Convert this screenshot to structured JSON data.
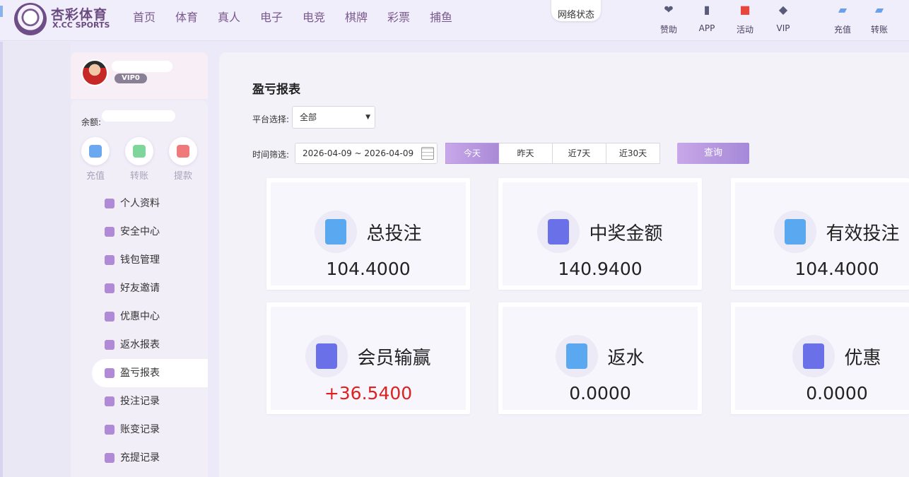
{
  "brand": {
    "name": "杏彩体育",
    "sub": "X.CC SPORTS"
  },
  "nav": [
    "首页",
    "体育",
    "真人",
    "电子",
    "电竞",
    "棋牌",
    "彩票",
    "捕鱼"
  ],
  "network_status": "网络状态",
  "header_icons": [
    {
      "label": "赞助",
      "icon": "heart-hands-icon",
      "color": "#5a5a7a"
    },
    {
      "label": "APP",
      "icon": "phone-icon",
      "color": "#5a5a7a"
    },
    {
      "label": "活动",
      "icon": "gift-icon",
      "color": "#e8453c"
    },
    {
      "label": "VIP",
      "icon": "diamond-icon",
      "color": "#5a5a7a"
    },
    {
      "label": "充值",
      "icon": "wallet-icon",
      "color": "#6aa0e8"
    },
    {
      "label": "转账",
      "icon": "transfer-icon",
      "color": "#6aa0e8"
    }
  ],
  "profile": {
    "vip": "VIP0",
    "balance_label": "余额:"
  },
  "quick_actions": [
    {
      "label": "充值",
      "icon": "deposit-icon",
      "color": "#6aa8f0"
    },
    {
      "label": "转账",
      "icon": "transfer-icon",
      "color": "#7ed69a"
    },
    {
      "label": "提款",
      "icon": "withdraw-icon",
      "color": "#f07a7a"
    }
  ],
  "menu": [
    {
      "label": "个人资料",
      "icon": "wallet-icon",
      "active": false
    },
    {
      "label": "安全中心",
      "icon": "shield-icon",
      "active": false
    },
    {
      "label": "钱包管理",
      "icon": "wallet-icon",
      "active": false
    },
    {
      "label": "好友邀请",
      "icon": "mail-icon",
      "active": false
    },
    {
      "label": "优惠中心",
      "icon": "coupon-icon",
      "active": false
    },
    {
      "label": "返水报表",
      "icon": "gift-box-icon",
      "active": false
    },
    {
      "label": "盈亏报表",
      "icon": "report-icon",
      "active": true
    },
    {
      "label": "投注记录",
      "icon": "report-icon",
      "active": false
    },
    {
      "label": "账变记录",
      "icon": "report-icon",
      "active": false
    },
    {
      "label": "充提记录",
      "icon": "report-icon",
      "active": false
    }
  ],
  "main": {
    "title": "盈亏报表",
    "platform_label": "平台选择:",
    "platform_value": "全部",
    "time_label": "时间筛选:",
    "date_range": "2026-04-09 ~ 2026-04-09",
    "tabs": [
      {
        "label": "今天",
        "active": true
      },
      {
        "label": "昨天",
        "active": false
      },
      {
        "label": "近7天",
        "active": false
      },
      {
        "label": "近30天",
        "active": false
      }
    ],
    "query_label": "查询",
    "stats": [
      {
        "name": "总投注",
        "value": "104.4000",
        "icon": "bet-slip-icon",
        "color": "#5aa8f0"
      },
      {
        "name": "中奖金额",
        "value": "140.9400",
        "icon": "trophy-ticket-icon",
        "color": "#6a70e8"
      },
      {
        "name": "有效投注",
        "value": "104.4000",
        "icon": "safe-icon",
        "color": "#5aa8f0"
      },
      {
        "name": "会员输赢",
        "value": "+36.5400",
        "icon": "member-icon",
        "color": "#6a70e8"
      },
      {
        "name": "返水",
        "value": "0.0000",
        "icon": "rebate-icon",
        "color": "#5aa8f0"
      },
      {
        "name": "优惠",
        "value": "0.0000",
        "icon": "promo-icon",
        "color": "#6a70e8"
      }
    ]
  }
}
